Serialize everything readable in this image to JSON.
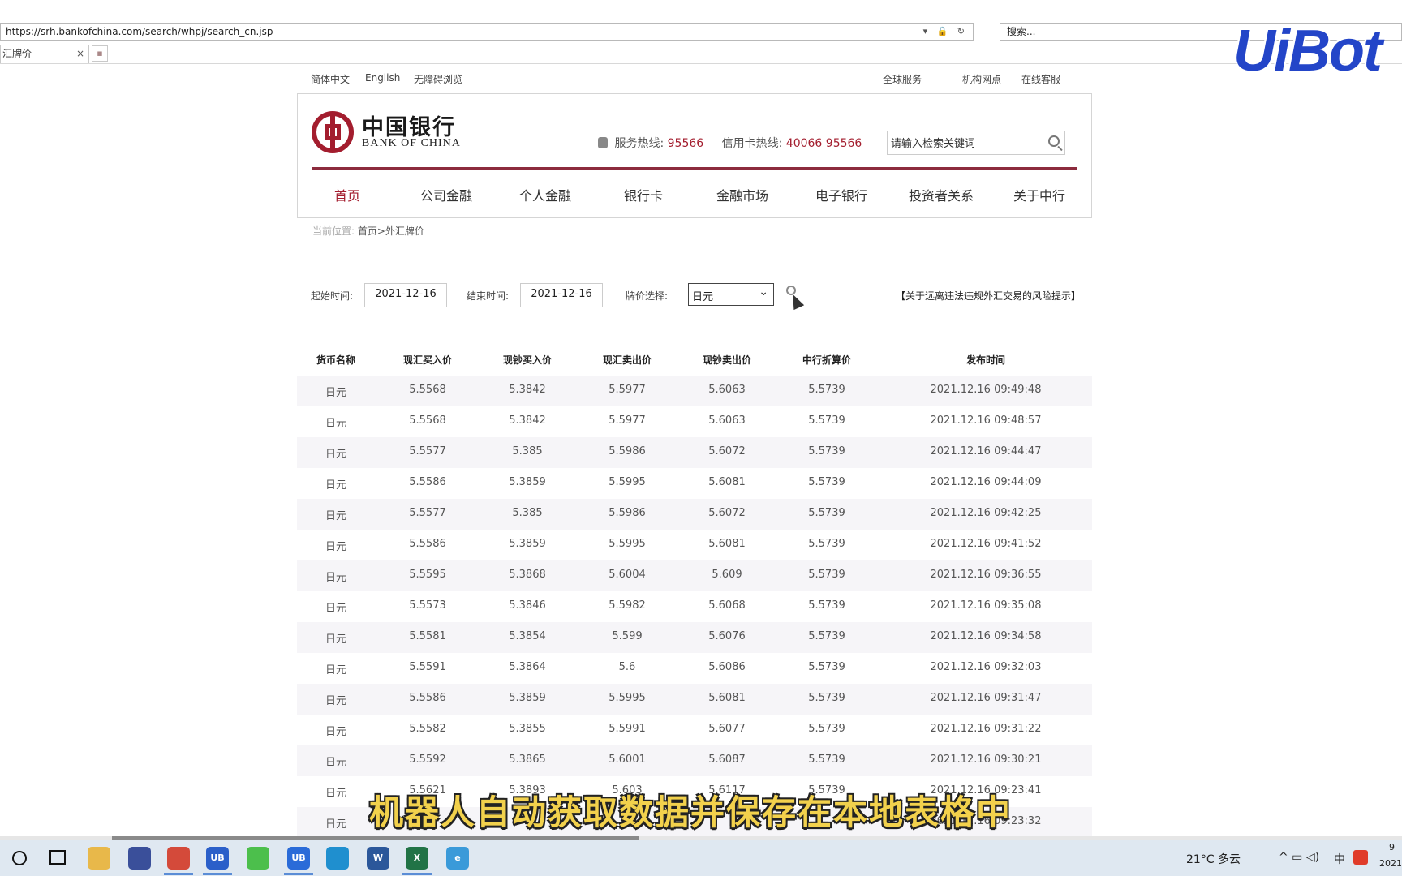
{
  "browser": {
    "url": "https://srh.bankofchina.com/search/whpj/search_cn.jsp",
    "search_placeholder": "搜索...",
    "tab_title": "汇牌价",
    "tab_close": "×"
  },
  "watermark": "UiBot",
  "util": {
    "left": [
      "简体中文",
      "English",
      "无障碍浏览"
    ],
    "right": [
      "全球服务",
      "机构网点",
      "在线客服"
    ]
  },
  "header": {
    "logo_cn": "中国银行",
    "logo_en": "BANK OF CHINA",
    "service_label": "服务热线:",
    "service_number": "95566",
    "card_label": "信用卡热线:",
    "card_number": "40066 95566",
    "search_placeholder": "请输入检索关键词"
  },
  "nav": [
    "首页",
    "公司金融",
    "个人金融",
    "银行卡",
    "金融市场",
    "电子银行",
    "投资者关系",
    "关于中行"
  ],
  "breadcrumb": {
    "label": "当前位置:",
    "path": "首页>外汇牌价"
  },
  "filters": {
    "start_label": "起始时间:",
    "start_value": "2021-12-16",
    "end_label": "结束时间:",
    "end_value": "2021-12-16",
    "currency_label": "牌价选择:",
    "currency_value": "日元",
    "risk_link": "【关于远离违法违规外汇交易的风险提示】"
  },
  "table": {
    "headers": [
      "货币名称",
      "现汇买入价",
      "现钞买入价",
      "现汇卖出价",
      "现钞卖出价",
      "中行折算价",
      "发布时间"
    ],
    "rows": [
      [
        "日元",
        "5.5568",
        "5.3842",
        "5.5977",
        "5.6063",
        "5.5739",
        "2021.12.16 09:49:48"
      ],
      [
        "日元",
        "5.5568",
        "5.3842",
        "5.5977",
        "5.6063",
        "5.5739",
        "2021.12.16 09:48:57"
      ],
      [
        "日元",
        "5.5577",
        "5.385",
        "5.5986",
        "5.6072",
        "5.5739",
        "2021.12.16 09:44:47"
      ],
      [
        "日元",
        "5.5586",
        "5.3859",
        "5.5995",
        "5.6081",
        "5.5739",
        "2021.12.16 09:44:09"
      ],
      [
        "日元",
        "5.5577",
        "5.385",
        "5.5986",
        "5.6072",
        "5.5739",
        "2021.12.16 09:42:25"
      ],
      [
        "日元",
        "5.5586",
        "5.3859",
        "5.5995",
        "5.6081",
        "5.5739",
        "2021.12.16 09:41:52"
      ],
      [
        "日元",
        "5.5595",
        "5.3868",
        "5.6004",
        "5.609",
        "5.5739",
        "2021.12.16 09:36:55"
      ],
      [
        "日元",
        "5.5573",
        "5.3846",
        "5.5982",
        "5.6068",
        "5.5739",
        "2021.12.16 09:35:08"
      ],
      [
        "日元",
        "5.5581",
        "5.3854",
        "5.599",
        "5.6076",
        "5.5739",
        "2021.12.16 09:34:58"
      ],
      [
        "日元",
        "5.5591",
        "5.3864",
        "5.6",
        "5.6086",
        "5.5739",
        "2021.12.16 09:32:03"
      ],
      [
        "日元",
        "5.5586",
        "5.3859",
        "5.5995",
        "5.6081",
        "5.5739",
        "2021.12.16 09:31:47"
      ],
      [
        "日元",
        "5.5582",
        "5.3855",
        "5.5991",
        "5.6077",
        "5.5739",
        "2021.12.16 09:31:22"
      ],
      [
        "日元",
        "5.5592",
        "5.3865",
        "5.6001",
        "5.6087",
        "5.5739",
        "2021.12.16 09:30:21"
      ],
      [
        "日元",
        "5.5621",
        "5.3893",
        "5.603",
        "5.6117",
        "5.5739",
        "2021.12.16 09:23:41"
      ],
      [
        "日元",
        "",
        "",
        "",
        "",
        "",
        "2021.12.16 09:23:32"
      ]
    ]
  },
  "subtitle": "机器人自动获取数据并保存在本地表格中",
  "taskbar": {
    "apps": [
      {
        "name": "file-explorer-icon",
        "label": "",
        "color": "#e8b84a"
      },
      {
        "name": "app-icon",
        "label": "",
        "color": "#3a4f9a"
      },
      {
        "name": "chrome-icon",
        "label": "",
        "color": "#d44a3a"
      },
      {
        "name": "uibot-creator-icon",
        "label": "UB",
        "color": "#2b5fc9"
      },
      {
        "name": "wechat-icon",
        "label": "",
        "color": "#4cbf4c"
      },
      {
        "name": "uibot-worker-icon",
        "label": "UB",
        "color": "#2a6bd8"
      },
      {
        "name": "edge-icon",
        "label": "",
        "color": "#1f8fcf"
      },
      {
        "name": "word-icon",
        "label": "W",
        "color": "#2b579a"
      },
      {
        "name": "excel-icon",
        "label": "X",
        "color": "#217346"
      },
      {
        "name": "ie-icon",
        "label": "e",
        "color": "#3a9ad9"
      }
    ],
    "weather": "21°C 多云",
    "ime": "中",
    "clock_line1": "9",
    "clock_line2": "2021"
  }
}
